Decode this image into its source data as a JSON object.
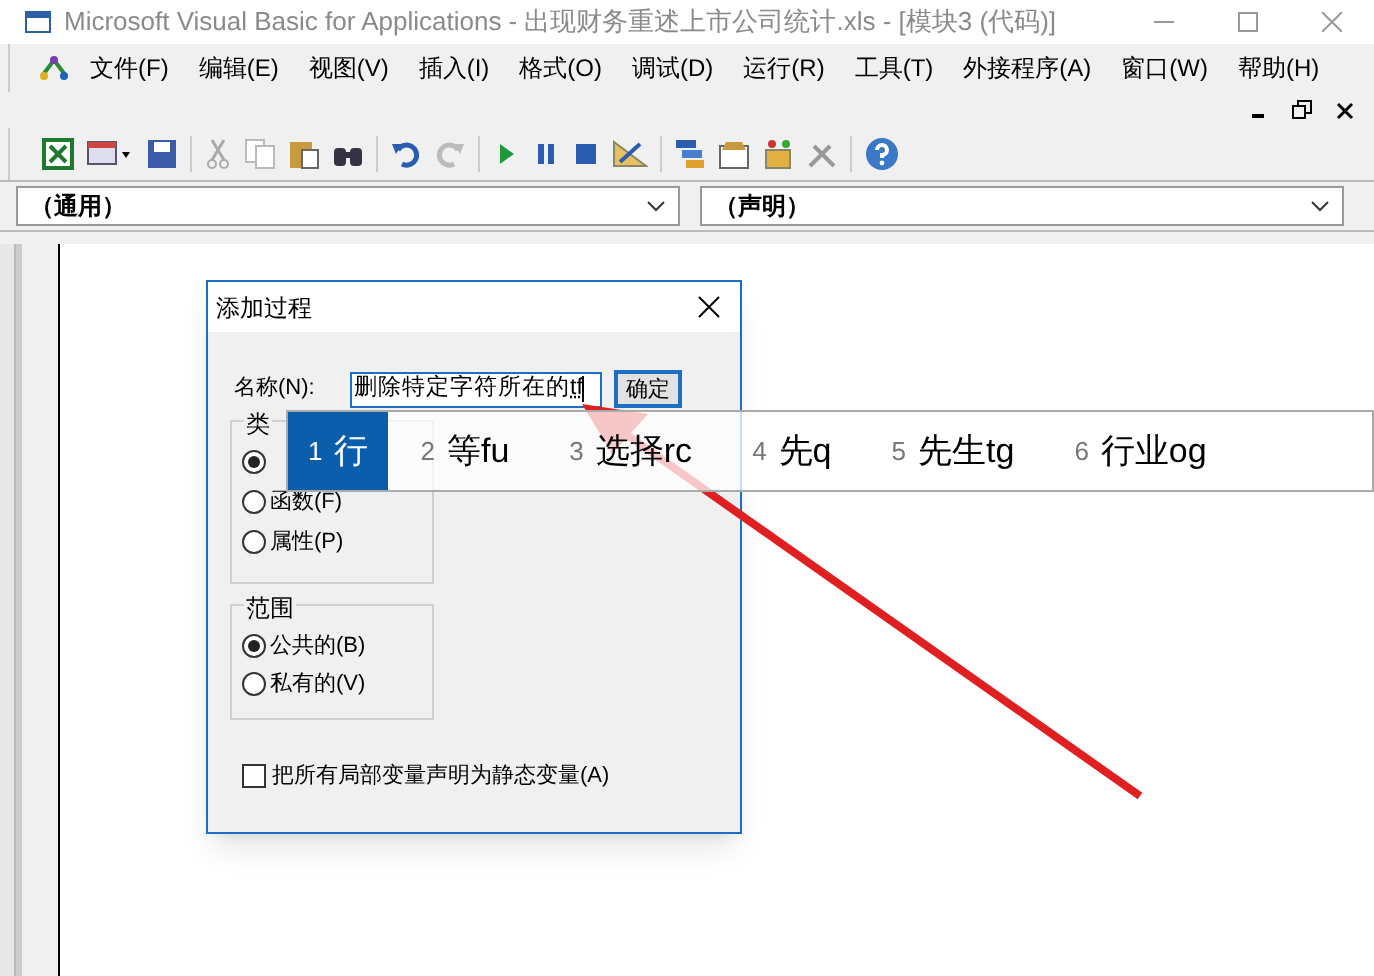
{
  "window": {
    "title": "Microsoft Visual Basic for Applications - 出现财务重述上市公司统计.xls - [模块3 (代码)]"
  },
  "menu": [
    "文件(F)",
    "编辑(E)",
    "视图(V)",
    "插入(I)",
    "格式(O)",
    "调试(D)",
    "运行(R)",
    "工具(T)",
    "外接程序(A)",
    "窗口(W)",
    "帮助(H)"
  ],
  "object_combo": {
    "value": "（通用）"
  },
  "procedure_combo": {
    "value": "（声明）"
  },
  "dialog": {
    "title": "添加过程",
    "name_label": "名称(N):",
    "name_value": "删除特定字符所在的",
    "name_composing": "tf",
    "ok_button": "确定",
    "type_group": {
      "title": "类",
      "options": [
        {
          "selected": true
        },
        {
          "label": "函数(F)",
          "selected": false
        },
        {
          "label": "属性(P)",
          "selected": false
        }
      ]
    },
    "scope_group": {
      "title": "范围",
      "options": [
        {
          "label": "公共的(B)",
          "selected": true
        },
        {
          "label": "私有的(V)",
          "selected": false
        }
      ]
    },
    "static_checkbox": {
      "label": "把所有局部变量声明为静态变量(A)",
      "checked": false
    }
  },
  "ime_candidates": [
    {
      "number": "1",
      "text": "行",
      "selected": true
    },
    {
      "number": "2",
      "text": "等fu",
      "selected": false
    },
    {
      "number": "3",
      "text": "选择rc",
      "selected": false
    },
    {
      "number": "4",
      "text": "先q",
      "selected": false
    },
    {
      "number": "5",
      "text": "先生tg",
      "selected": false
    },
    {
      "number": "6",
      "text": "行业og",
      "selected": false
    }
  ]
}
